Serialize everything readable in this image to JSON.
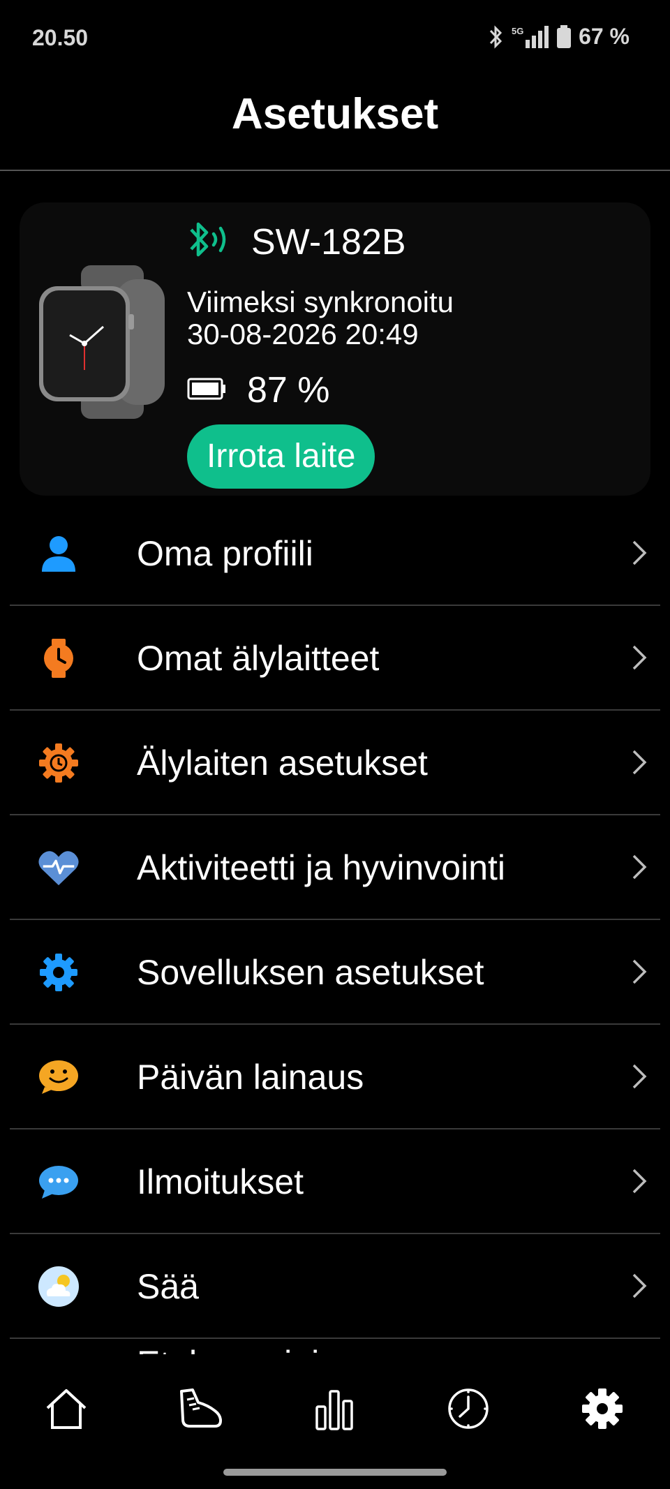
{
  "status": {
    "time": "20.50",
    "network": "5G",
    "battery": "67 %"
  },
  "header": {
    "title": "Asetukset"
  },
  "device": {
    "name": "SW-182B",
    "sync_label": "Viimeksi synkronoitu",
    "sync_date": "30-08-2026 20:49",
    "battery": "87 %",
    "disconnect_label": "Irrota laite"
  },
  "menu": {
    "items": [
      {
        "label": "Oma profiili",
        "icon": "person-icon"
      },
      {
        "label": "Omat älylaitteet",
        "icon": "smartwatch-icon"
      },
      {
        "label": "Älylaiten asetukset",
        "icon": "watch-settings-icon"
      },
      {
        "label": "Aktiviteetti ja hyvinvointi",
        "icon": "heart-pulse-icon"
      },
      {
        "label": "Sovelluksen asetukset",
        "icon": "gear-icon"
      },
      {
        "label": "Päivän lainaus",
        "icon": "smiley-chat-icon"
      },
      {
        "label": "Ilmoitukset",
        "icon": "message-icon"
      },
      {
        "label": "Sää",
        "icon": "weather-icon"
      }
    ],
    "partial_item": "Etukammioinen"
  },
  "tabbar": {
    "tabs": [
      "home-icon",
      "running-shoe-icon",
      "bar-chart-icon",
      "clock-icon",
      "gear-icon"
    ]
  },
  "colors": {
    "accent": "#0fbf8c",
    "profile": "#1e9bff",
    "orange": "#f47b20",
    "heart": "#5b8fd6",
    "quote": "#f5a623",
    "message": "#3aa0f0"
  }
}
